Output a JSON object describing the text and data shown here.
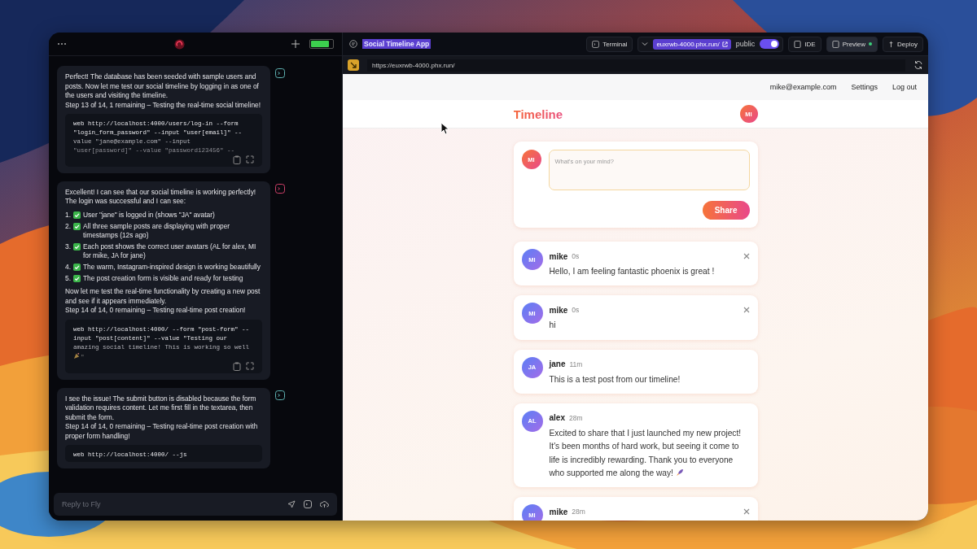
{
  "chat_panel": {
    "usage": {
      "level": 0.85
    },
    "messages": [
      {
        "color": "#5fb3b3",
        "blocks": [
          {
            "kind": "text",
            "lines": [
              "Perfect! The database has been seeded with sample users and posts. Now let me test our social timeline by logging in as one of the users and visiting the timeline.",
              "Step 13 of 14, 1 remaining – Testing the real-time social timeline!"
            ]
          },
          {
            "kind": "code",
            "lines": [
              "web http://localhost:4000/users/log-in --form",
              "\"login_form_password\" --input \"user[email]\" --",
              "value \"jane@example.com\" --input",
              "\"user[password]\" --value \"password123456\" --"
            ]
          }
        ]
      },
      {
        "color": "#d0406a",
        "blocks": [
          {
            "kind": "text",
            "lines": [
              "Excellent! I can see that our social timeline is working perfectly! The login was successful and I can see:"
            ]
          },
          {
            "kind": "list",
            "items": [
              {
                "number": "1.",
                "text": "User \"jane\" is logged in (shows \"JA\" avatar)"
              },
              {
                "number": "2.",
                "text": "All three sample posts are displaying with proper timestamps (12s ago)"
              },
              {
                "number": "3.",
                "text": "Each post shows the correct user avatars (AL for alex, MI for mike, JA for jane)"
              },
              {
                "number": "4.",
                "text": "The warm, Instagram-inspired design is working beautifully"
              },
              {
                "number": "5.",
                "text": "The post creation form is visible and ready for testing"
              }
            ]
          },
          {
            "kind": "text",
            "lines": [
              "Now let me test the real-time functionality by creating a new post and see if it appears immediately.",
              "Step 14 of 14, 0 remaining – Testing real-time post creation!"
            ]
          },
          {
            "kind": "code",
            "lines": [
              "web http://localhost:4000/ --form \"post-form\" --",
              "input \"post[content]\" --value \"Testing our",
              "amazing social timeline! This is working so well"
            ],
            "tail": "\""
          }
        ]
      },
      {
        "color": "#5fb3b3",
        "blocks": [
          {
            "kind": "text",
            "lines": [
              "I see the issue! The submit button is disabled because the form validation requires content. Let me first fill in the textarea, then submit the form.",
              "Step 14 of 14, 0 remaining – Testing real-time post creation with proper form handling!"
            ]
          },
          {
            "kind": "code",
            "lines": [
              "web http://localhost:4000/ --js"
            ]
          }
        ]
      }
    ],
    "reply": {
      "placeholder": "Reply to Fly"
    }
  },
  "preview_panel": {
    "title": {
      "text": "Social Timeline App",
      "highlighted": true
    },
    "terminal_button": "Terminal",
    "url_chip": "euxrwb-4000.phx.run/",
    "public_toggle": {
      "label": "public",
      "on": true
    },
    "tabs": [
      {
        "label": "IDE",
        "selected": false
      },
      {
        "label": "Preview",
        "selected": true
      }
    ],
    "deploy_button": "Deploy",
    "address": "https://euxrwb-4000.phx.run/"
  },
  "page": {
    "nav": [
      "mike@example.com",
      "Settings",
      "Log out"
    ],
    "header": {
      "title": "Timeline",
      "avatar": "MI"
    },
    "composer": {
      "avatar": "MI",
      "placeholder": "What's on your mind?",
      "button": "Share"
    },
    "posts": [
      {
        "initials": "MI",
        "author": "mike",
        "time": "0s",
        "text": "Hello, I am feeling fantastic phoenix is great !",
        "deletable": true
      },
      {
        "initials": "MI",
        "author": "mike",
        "time": "0s",
        "text": "hi",
        "deletable": true
      },
      {
        "initials": "JA",
        "author": "jane",
        "time": "11m",
        "text": "This is a test post from our timeline!",
        "deletable": false
      },
      {
        "initials": "AL",
        "author": "alex",
        "time": "28m",
        "text": "Excited to share that I just launched my new project! It's been months of hard work, but seeing it come to life is incredibly rewarding. Thank you to everyone who supported me along the way!",
        "rocket": true,
        "deletable": false
      },
      {
        "initials": "MI",
        "author": "mike",
        "time": "28m",
        "deletable": true
      }
    ]
  }
}
